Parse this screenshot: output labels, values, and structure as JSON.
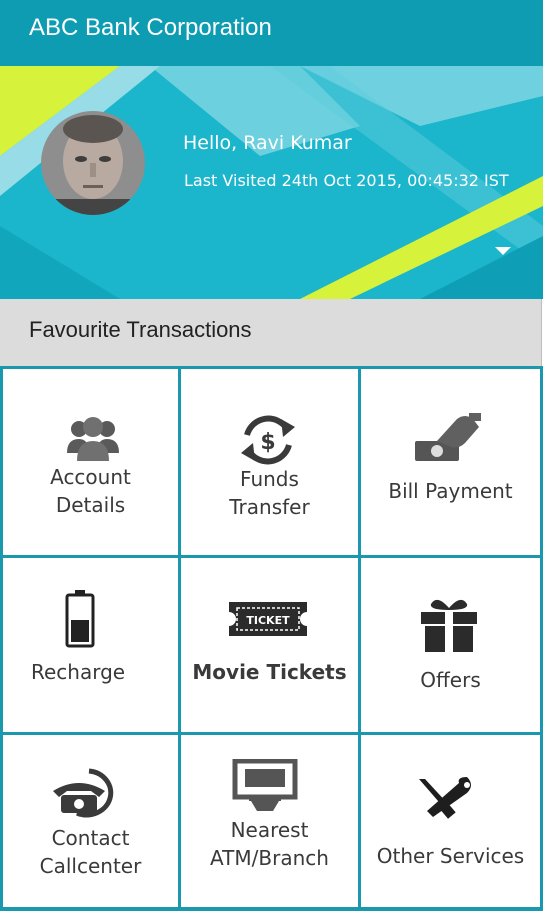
{
  "app": {
    "title": "ABC Bank Corporation"
  },
  "profile": {
    "greeting": "Hello, Ravi Kumar",
    "last_visited": "Last Visited 24th Oct 2015, 00:45:32 IST"
  },
  "section": {
    "title": "Favourite Transactions"
  },
  "tiles": [
    {
      "label_line1": "Account",
      "label_line2": "Details",
      "icon": "people-icon"
    },
    {
      "label_line1": "Funds",
      "label_line2": "Transfer",
      "icon": "money-transfer-icon"
    },
    {
      "label_line1": "Bill Payment",
      "label_line2": "",
      "icon": "hand-cash-icon"
    },
    {
      "label_line1": "Recharge",
      "label_line2": "",
      "icon": "battery-icon"
    },
    {
      "label_line1": "Movie Tickets",
      "label_line2": "",
      "icon": "ticket-icon",
      "ticket_text": "TICKET"
    },
    {
      "label_line1": "Offers",
      "label_line2": "",
      "icon": "gift-icon"
    },
    {
      "label_line1": "Contact",
      "label_line2": "Callcenter",
      "icon": "phone-icon"
    },
    {
      "label_line1": "Nearest",
      "label_line2": "ATM/Branch",
      "icon": "atm-icon"
    },
    {
      "label_line1": "Other Services",
      "label_line2": "",
      "icon": "tools-icon"
    }
  ],
  "colors": {
    "primary": "#0d9cb2",
    "banner": "#1bb5cc",
    "accent_yellow": "#d6f23a",
    "grid_line": "#1a98ad"
  }
}
